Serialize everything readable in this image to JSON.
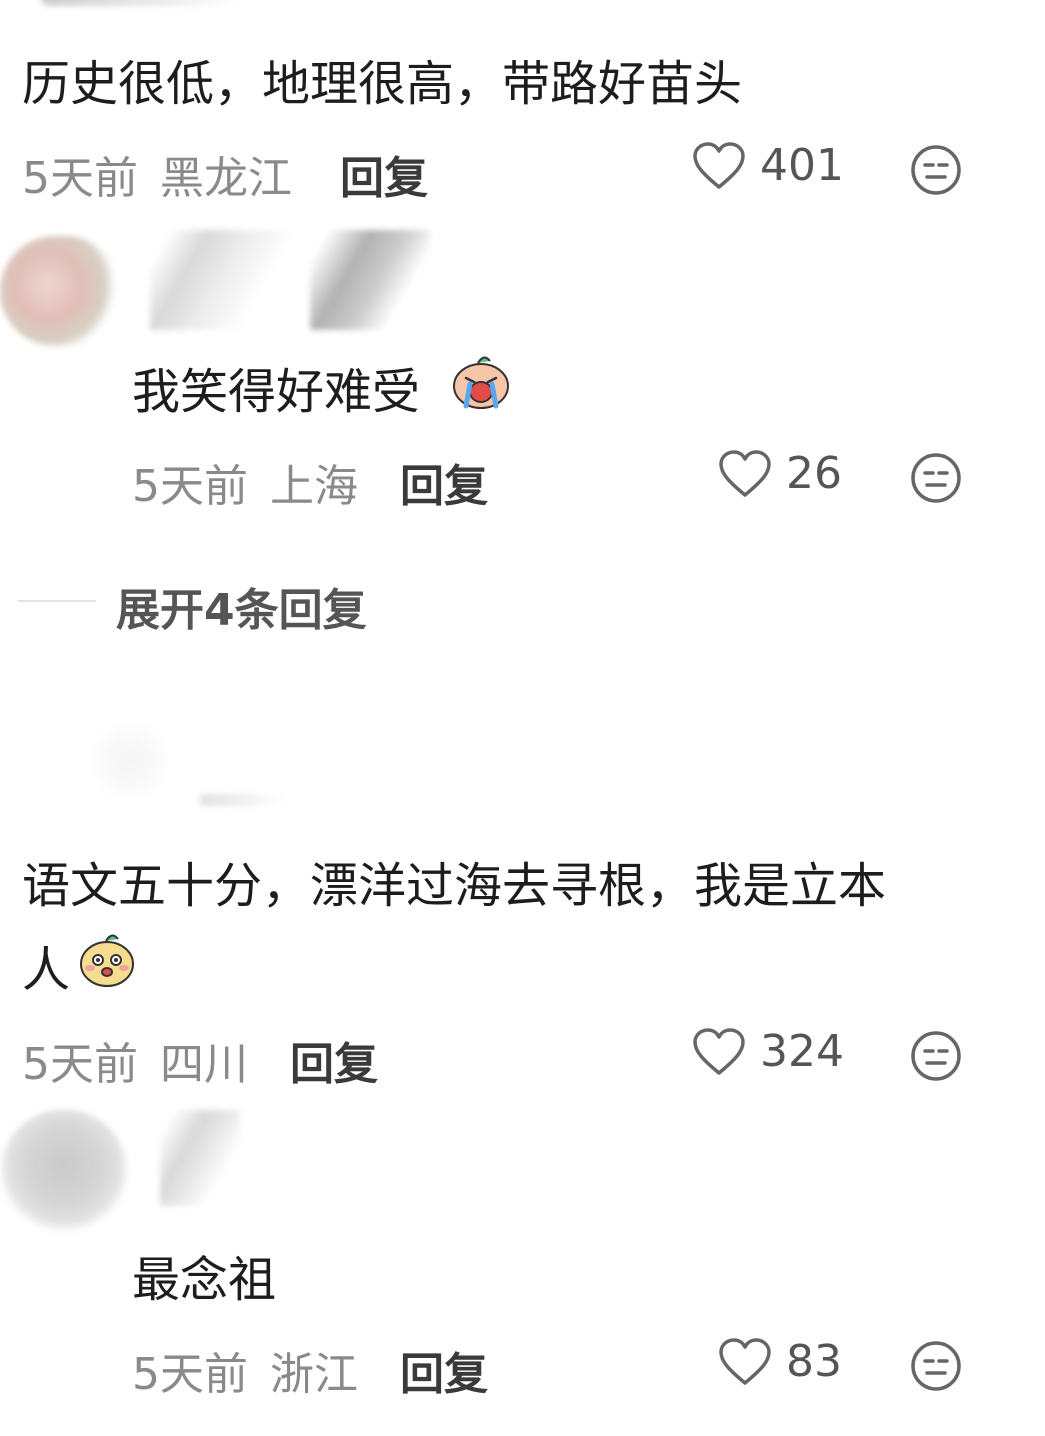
{
  "comments": [
    {
      "text": "历史很低，地理很高，带路好苗头",
      "time": "5天前",
      "location": "黑龙江",
      "reply_label": "回复",
      "likes": "401"
    },
    {
      "text": "我笑得好难受",
      "emoji": "crying-laughing-emoji",
      "time": "5天前",
      "location": "上海",
      "reply_label": "回复",
      "likes": "26"
    },
    {
      "text_line1": "语文五十分，漂洋过海去寻根，我是立本",
      "text_line2": "人",
      "emoji": "dog-face-emoji",
      "time": "5天前",
      "location": "四川",
      "reply_label": "回复",
      "likes": "324"
    },
    {
      "text": "最念祖",
      "time": "5天前",
      "location": "浙江",
      "reply_label": "回复",
      "likes": "83"
    }
  ],
  "expand_replies": "展开4条回复",
  "colors": {
    "text": "#1d1d1d",
    "meta": "#8a8a8a",
    "icon": "#666666"
  },
  "icons": [
    "heart-outline-icon",
    "neutral-face-icon",
    "crying-laughing-emoji",
    "dog-face-emoji"
  ]
}
